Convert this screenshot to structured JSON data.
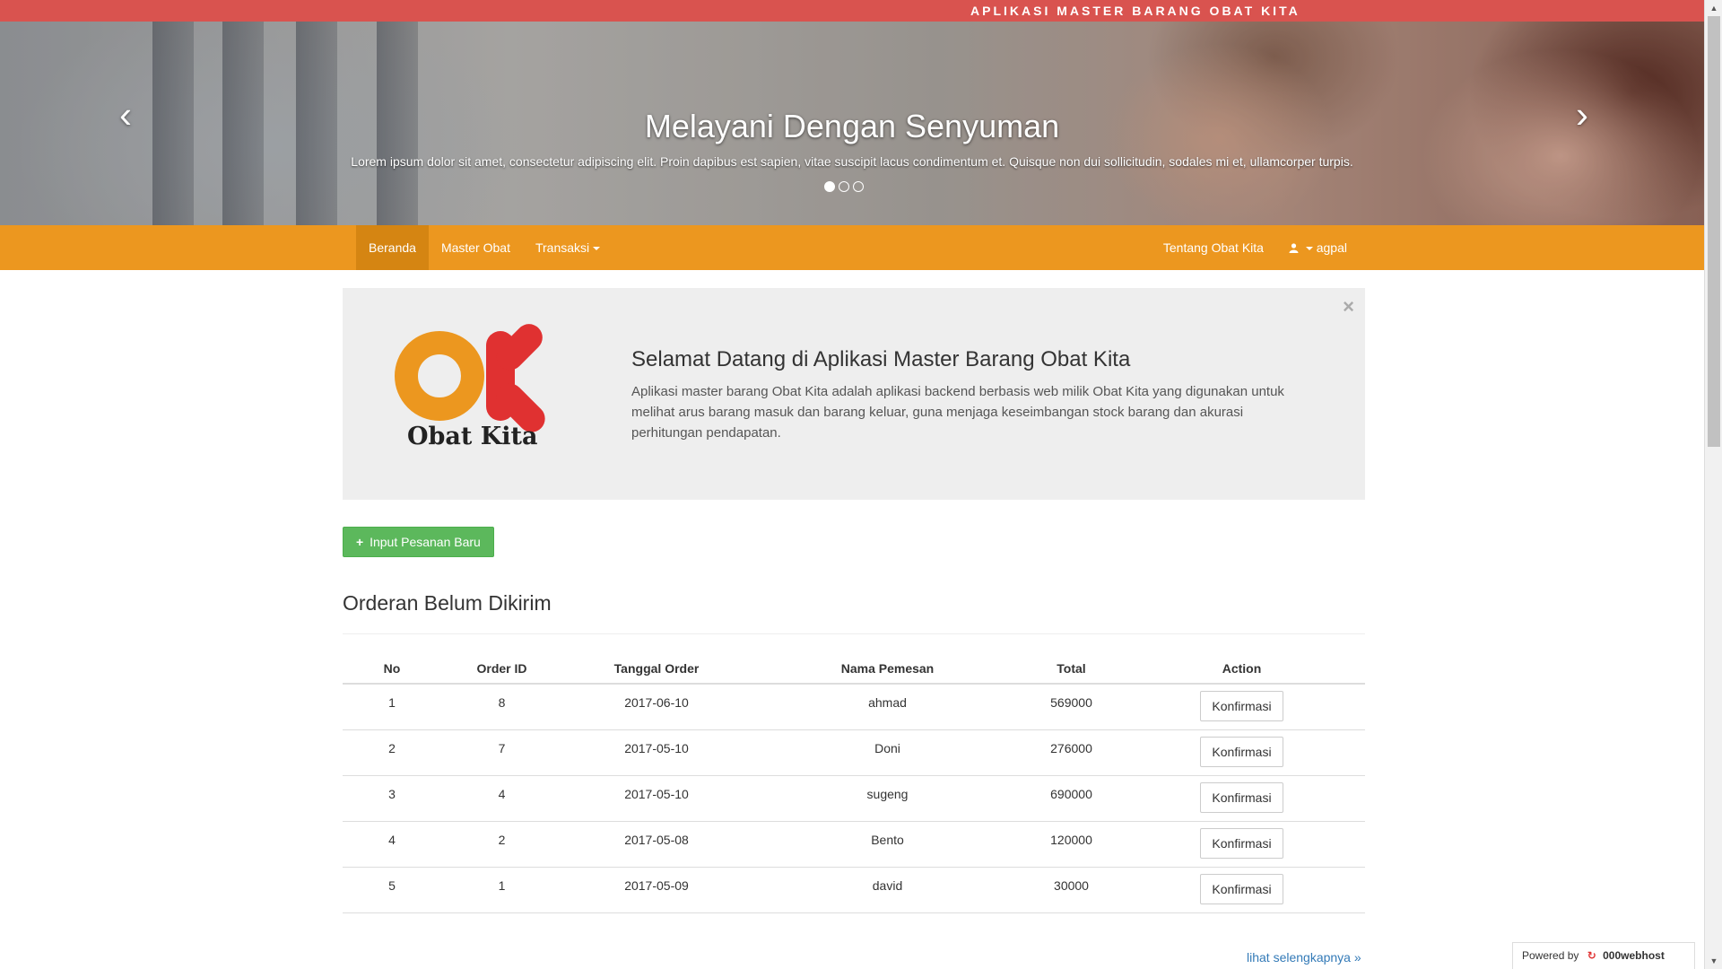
{
  "header": {
    "app_title": "APLIKASI MASTER BARANG OBAT KITA"
  },
  "carousel": {
    "title": "Melayani Dengan Senyuman",
    "text": "Lorem ipsum dolor sit amet, consectetur adipiscing elit. Proin dapibus est sapien, vitae suscipit lacus condimentum et. Quisque non dui sollicitudin, sodales mi et, ullamcorper turpis.",
    "prev_icon": "‹",
    "next_icon": "›",
    "slide_count": 3,
    "active_slide": 1
  },
  "nav": {
    "items": [
      {
        "label": "Beranda",
        "active": true
      },
      {
        "label": "Master Obat",
        "active": false
      },
      {
        "label": "Transaksi",
        "active": false,
        "dropdown": true
      }
    ],
    "right": {
      "about": "Tentang Obat Kita",
      "user": "agpal",
      "user_icon": "user-icon"
    }
  },
  "welcome": {
    "logo_text": "Obat Kita",
    "heading": "Selamat Datang di Aplikasi Master Barang Obat Kita",
    "body": "Aplikasi master barang Obat Kita adalah aplikasi backend berbasis web milik Obat Kita yang digunakan untuk melihat arus barang masuk dan barang keluar, guna menjaga keseimbangan stock barang dan akurasi perhitungan pendapatan.",
    "close": "×"
  },
  "actions": {
    "new_order": "Input Pesanan Baru"
  },
  "orders": {
    "title": "Orderan Belum Dikirim",
    "columns": [
      "No",
      "Order ID",
      "Tanggal Order",
      "Nama Pemesan",
      "Total",
      "Action"
    ],
    "rows": [
      {
        "no": "1",
        "order_id": "8",
        "date": "2017-06-10",
        "name": "ahmad",
        "total": "569000",
        "action": "Konfirmasi"
      },
      {
        "no": "2",
        "order_id": "7",
        "date": "2017-05-10",
        "name": "Doni",
        "total": "276000",
        "action": "Konfirmasi"
      },
      {
        "no": "3",
        "order_id": "4",
        "date": "2017-05-10",
        "name": "sugeng",
        "total": "690000",
        "action": "Konfirmasi"
      },
      {
        "no": "4",
        "order_id": "2",
        "date": "2017-05-08",
        "name": "Bento",
        "total": "120000",
        "action": "Konfirmasi"
      },
      {
        "no": "5",
        "order_id": "1",
        "date": "2017-05-09",
        "name": "david",
        "total": "30000",
        "action": "Konfirmasi"
      }
    ],
    "more_link": "lihat selengkapnya »"
  },
  "footer": {
    "powered_by": "Powered by",
    "host": "000webhost"
  },
  "colors": {
    "top_strip": "#d9534f",
    "navbar": "#ec971f",
    "navbar_active": "#d58512",
    "success": "#5cb85c",
    "logo_orange": "#ec971f",
    "logo_red": "#e03131",
    "link": "#337ab7"
  }
}
